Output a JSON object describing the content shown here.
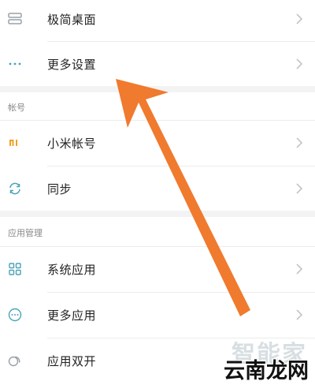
{
  "settings": {
    "rows": [
      {
        "label": "极简桌面",
        "icon": "minimal-desktop-icon"
      },
      {
        "label": "更多设置",
        "icon": "more-dots-icon"
      }
    ],
    "account": {
      "title": "帐号",
      "rows": [
        {
          "label": "小米帐号",
          "icon": "mi-logo-icon"
        },
        {
          "label": "同步",
          "icon": "sync-icon"
        }
      ]
    },
    "apps": {
      "title": "应用管理",
      "rows": [
        {
          "label": "系统应用",
          "icon": "grid-icon"
        },
        {
          "label": "更多应用",
          "icon": "more-circle-icon"
        },
        {
          "label": "应用双开",
          "icon": "dual-app-icon"
        }
      ]
    }
  },
  "watermark": {
    "top": "智能家",
    "bottom": "云南龙网"
  },
  "colors": {
    "arrow": "#f07a2e",
    "icon_gray": "#9aa0a6",
    "icon_teal": "#4aa3b8",
    "mi_orange": "#f0a020"
  }
}
